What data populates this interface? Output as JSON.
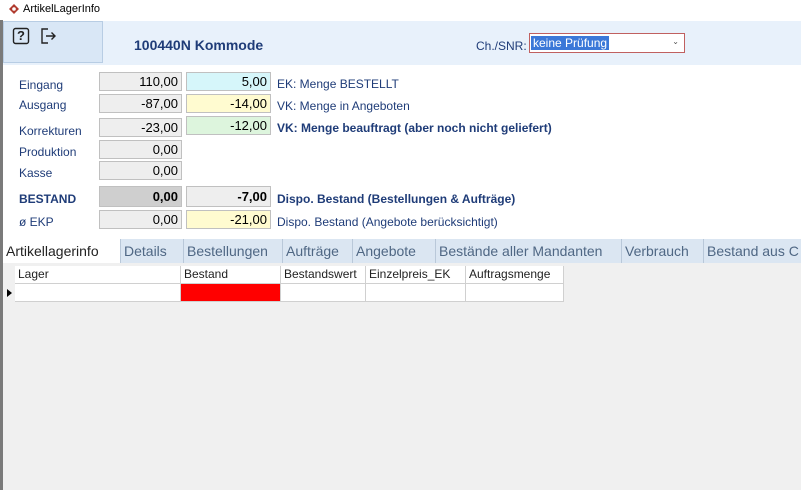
{
  "window": {
    "title": "ArtikelLagerInfo"
  },
  "toolbar": {
    "help_label": "?"
  },
  "article": {
    "title": "100440N Kommode"
  },
  "chsnr": {
    "label": "Ch./SNR:",
    "value": "keine Prüfung"
  },
  "stock": {
    "rows": [
      {
        "label": "Eingang",
        "value": "110,00"
      },
      {
        "label": "Ausgang",
        "value": "-87,00"
      },
      {
        "label": "Korrekturen",
        "value": "-23,00"
      },
      {
        "label": "Produktion",
        "value": "0,00"
      },
      {
        "label": "Kasse",
        "value": "0,00"
      }
    ],
    "bestand_label": "BESTAND",
    "bestand_value": "0,00",
    "ekp_label": "ø EKP",
    "ekp_value": "0,00"
  },
  "dispo": {
    "ek_bestellt_value": "5,00",
    "ek_bestellt_label": "EK: Menge BESTELLT",
    "vk_angebote_value": "-14,00",
    "vk_angebote_label": "VK: Menge in Angeboten",
    "vk_beauftragt_value": "-12,00",
    "vk_beauftragt_label": "VK: Menge beauftragt (aber noch nicht geliefert)",
    "dispo_bestand_value": "-7,00",
    "dispo_bestand_label": "Dispo. Bestand (Bestellungen & Aufträge)",
    "dispo_angebote_value": "-21,00",
    "dispo_angebote_label": "Dispo. Bestand (Angebote berücksichtigt)"
  },
  "tabs": [
    "Artikellagerinfo",
    "Details",
    "Bestellungen",
    "Aufträge",
    "Angebote",
    "Bestände aller Mandanten",
    "Verbrauch",
    "Bestand aus C"
  ],
  "grid": {
    "columns": [
      "Lager",
      "Bestand",
      "Bestandswert",
      "Einzelpreis_EK",
      "Auftragsmenge"
    ],
    "highlight_color": "#ff0000"
  }
}
